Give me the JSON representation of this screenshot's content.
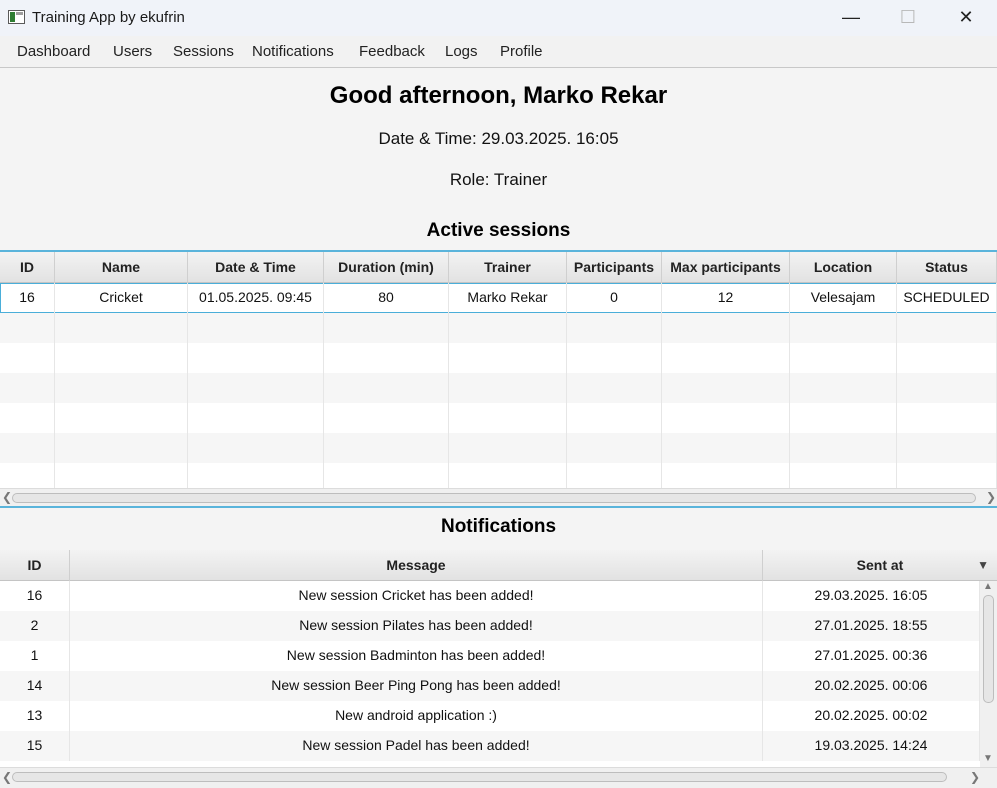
{
  "window": {
    "title": "Training App by ekufrin",
    "minimize_glyph": "—",
    "maximize_glyph": "☐",
    "close_glyph": "✕"
  },
  "menu": [
    "Dashboard",
    "Users",
    "Sessions",
    "Notifications",
    "Feedback",
    "Logs",
    "Profile"
  ],
  "dashboard": {
    "greeting": "Good afternoon, Marko Rekar",
    "datetime": "Date & Time: 29.03.2025. 16:05",
    "role": "Role: Trainer"
  },
  "sessions": {
    "title": "Active sessions",
    "columns": [
      "ID",
      "Name",
      "Date & Time",
      "Duration (min)",
      "Trainer",
      "Participants",
      "Max participants",
      "Location",
      "Status"
    ],
    "rows": [
      [
        "16",
        "Cricket",
        "01.05.2025. 09:45",
        "80",
        "Marko Rekar",
        "0",
        "12",
        "Velesajam",
        "SCHEDULED"
      ]
    ]
  },
  "notifications": {
    "title": "Notifications",
    "columns": [
      "ID",
      "Message",
      "Sent at"
    ],
    "sort_indicator": "▼",
    "rows": [
      [
        "16",
        "New session Cricket has been added!",
        "29.03.2025. 16:05"
      ],
      [
        "2",
        "New session Pilates has been added!",
        "27.01.2025. 18:55"
      ],
      [
        "1",
        "New session Badminton has been added!",
        "27.01.2025. 00:36"
      ],
      [
        "14",
        "New session Beer Ping Pong has been added!",
        "20.02.2025. 00:06"
      ],
      [
        "13",
        "New android application :)",
        "20.02.2025. 00:02"
      ],
      [
        "15",
        "New session Padel has been added!",
        "19.03.2025. 14:24"
      ]
    ]
  }
}
